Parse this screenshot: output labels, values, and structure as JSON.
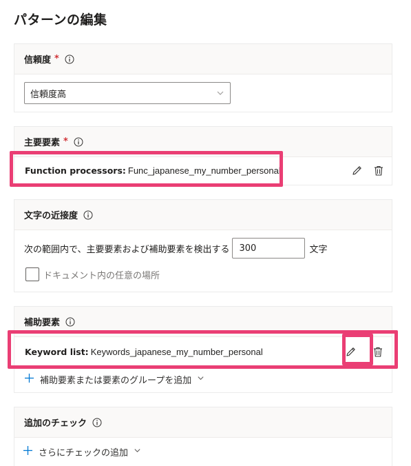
{
  "page": {
    "title": "パターンの編集"
  },
  "confidence": {
    "title": "信頼度",
    "required_mark": "*",
    "selected": "信頼度高"
  },
  "primary": {
    "title": "主要要素",
    "required_mark": "*",
    "kind": "Function processors:",
    "value": "Func_japanese_my_number_personal"
  },
  "proximity": {
    "title": "文字の近接度",
    "label_before": "次の範囲内で、主要要素および補助要素を検出する",
    "value": "300",
    "label_after": "文字",
    "checkbox_label": "ドキュメント内の任意の場所"
  },
  "supporting": {
    "title": "補助要素",
    "kind": "Keyword list:",
    "value": "Keywords_japanese_my_number_personal",
    "add_label": "補助要素または要素のグループを追加"
  },
  "checks": {
    "title": "追加のチェック",
    "add_label": "さらにチェックの追加"
  },
  "colors": {
    "highlight": "#ea3e74",
    "required": "#d13438",
    "header_bg": "#faf9f8"
  },
  "icons": [
    "info-icon",
    "chevron-down-icon",
    "pencil-icon",
    "trash-icon",
    "plus-icon"
  ]
}
